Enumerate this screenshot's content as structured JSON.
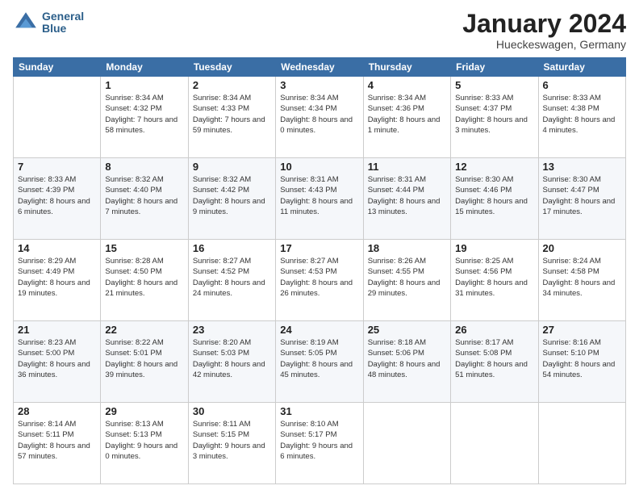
{
  "header": {
    "logo_line1": "General",
    "logo_line2": "Blue",
    "month": "January 2024",
    "location": "Hueckeswagen, Germany"
  },
  "weekdays": [
    "Sunday",
    "Monday",
    "Tuesday",
    "Wednesday",
    "Thursday",
    "Friday",
    "Saturday"
  ],
  "weeks": [
    [
      {
        "day": "",
        "sunrise": "",
        "sunset": "",
        "daylight": ""
      },
      {
        "day": "1",
        "sunrise": "Sunrise: 8:34 AM",
        "sunset": "Sunset: 4:32 PM",
        "daylight": "Daylight: 7 hours and 58 minutes."
      },
      {
        "day": "2",
        "sunrise": "Sunrise: 8:34 AM",
        "sunset": "Sunset: 4:33 PM",
        "daylight": "Daylight: 7 hours and 59 minutes."
      },
      {
        "day": "3",
        "sunrise": "Sunrise: 8:34 AM",
        "sunset": "Sunset: 4:34 PM",
        "daylight": "Daylight: 8 hours and 0 minutes."
      },
      {
        "day": "4",
        "sunrise": "Sunrise: 8:34 AM",
        "sunset": "Sunset: 4:36 PM",
        "daylight": "Daylight: 8 hours and 1 minute."
      },
      {
        "day": "5",
        "sunrise": "Sunrise: 8:33 AM",
        "sunset": "Sunset: 4:37 PM",
        "daylight": "Daylight: 8 hours and 3 minutes."
      },
      {
        "day": "6",
        "sunrise": "Sunrise: 8:33 AM",
        "sunset": "Sunset: 4:38 PM",
        "daylight": "Daylight: 8 hours and 4 minutes."
      }
    ],
    [
      {
        "day": "7",
        "sunrise": "Sunrise: 8:33 AM",
        "sunset": "Sunset: 4:39 PM",
        "daylight": "Daylight: 8 hours and 6 minutes."
      },
      {
        "day": "8",
        "sunrise": "Sunrise: 8:32 AM",
        "sunset": "Sunset: 4:40 PM",
        "daylight": "Daylight: 8 hours and 7 minutes."
      },
      {
        "day": "9",
        "sunrise": "Sunrise: 8:32 AM",
        "sunset": "Sunset: 4:42 PM",
        "daylight": "Daylight: 8 hours and 9 minutes."
      },
      {
        "day": "10",
        "sunrise": "Sunrise: 8:31 AM",
        "sunset": "Sunset: 4:43 PM",
        "daylight": "Daylight: 8 hours and 11 minutes."
      },
      {
        "day": "11",
        "sunrise": "Sunrise: 8:31 AM",
        "sunset": "Sunset: 4:44 PM",
        "daylight": "Daylight: 8 hours and 13 minutes."
      },
      {
        "day": "12",
        "sunrise": "Sunrise: 8:30 AM",
        "sunset": "Sunset: 4:46 PM",
        "daylight": "Daylight: 8 hours and 15 minutes."
      },
      {
        "day": "13",
        "sunrise": "Sunrise: 8:30 AM",
        "sunset": "Sunset: 4:47 PM",
        "daylight": "Daylight: 8 hours and 17 minutes."
      }
    ],
    [
      {
        "day": "14",
        "sunrise": "Sunrise: 8:29 AM",
        "sunset": "Sunset: 4:49 PM",
        "daylight": "Daylight: 8 hours and 19 minutes."
      },
      {
        "day": "15",
        "sunrise": "Sunrise: 8:28 AM",
        "sunset": "Sunset: 4:50 PM",
        "daylight": "Daylight: 8 hours and 21 minutes."
      },
      {
        "day": "16",
        "sunrise": "Sunrise: 8:27 AM",
        "sunset": "Sunset: 4:52 PM",
        "daylight": "Daylight: 8 hours and 24 minutes."
      },
      {
        "day": "17",
        "sunrise": "Sunrise: 8:27 AM",
        "sunset": "Sunset: 4:53 PM",
        "daylight": "Daylight: 8 hours and 26 minutes."
      },
      {
        "day": "18",
        "sunrise": "Sunrise: 8:26 AM",
        "sunset": "Sunset: 4:55 PM",
        "daylight": "Daylight: 8 hours and 29 minutes."
      },
      {
        "day": "19",
        "sunrise": "Sunrise: 8:25 AM",
        "sunset": "Sunset: 4:56 PM",
        "daylight": "Daylight: 8 hours and 31 minutes."
      },
      {
        "day": "20",
        "sunrise": "Sunrise: 8:24 AM",
        "sunset": "Sunset: 4:58 PM",
        "daylight": "Daylight: 8 hours and 34 minutes."
      }
    ],
    [
      {
        "day": "21",
        "sunrise": "Sunrise: 8:23 AM",
        "sunset": "Sunset: 5:00 PM",
        "daylight": "Daylight: 8 hours and 36 minutes."
      },
      {
        "day": "22",
        "sunrise": "Sunrise: 8:22 AM",
        "sunset": "Sunset: 5:01 PM",
        "daylight": "Daylight: 8 hours and 39 minutes."
      },
      {
        "day": "23",
        "sunrise": "Sunrise: 8:20 AM",
        "sunset": "Sunset: 5:03 PM",
        "daylight": "Daylight: 8 hours and 42 minutes."
      },
      {
        "day": "24",
        "sunrise": "Sunrise: 8:19 AM",
        "sunset": "Sunset: 5:05 PM",
        "daylight": "Daylight: 8 hours and 45 minutes."
      },
      {
        "day": "25",
        "sunrise": "Sunrise: 8:18 AM",
        "sunset": "Sunset: 5:06 PM",
        "daylight": "Daylight: 8 hours and 48 minutes."
      },
      {
        "day": "26",
        "sunrise": "Sunrise: 8:17 AM",
        "sunset": "Sunset: 5:08 PM",
        "daylight": "Daylight: 8 hours and 51 minutes."
      },
      {
        "day": "27",
        "sunrise": "Sunrise: 8:16 AM",
        "sunset": "Sunset: 5:10 PM",
        "daylight": "Daylight: 8 hours and 54 minutes."
      }
    ],
    [
      {
        "day": "28",
        "sunrise": "Sunrise: 8:14 AM",
        "sunset": "Sunset: 5:11 PM",
        "daylight": "Daylight: 8 hours and 57 minutes."
      },
      {
        "day": "29",
        "sunrise": "Sunrise: 8:13 AM",
        "sunset": "Sunset: 5:13 PM",
        "daylight": "Daylight: 9 hours and 0 minutes."
      },
      {
        "day": "30",
        "sunrise": "Sunrise: 8:11 AM",
        "sunset": "Sunset: 5:15 PM",
        "daylight": "Daylight: 9 hours and 3 minutes."
      },
      {
        "day": "31",
        "sunrise": "Sunrise: 8:10 AM",
        "sunset": "Sunset: 5:17 PM",
        "daylight": "Daylight: 9 hours and 6 minutes."
      },
      {
        "day": "",
        "sunrise": "",
        "sunset": "",
        "daylight": ""
      },
      {
        "day": "",
        "sunrise": "",
        "sunset": "",
        "daylight": ""
      },
      {
        "day": "",
        "sunrise": "",
        "sunset": "",
        "daylight": ""
      }
    ]
  ]
}
